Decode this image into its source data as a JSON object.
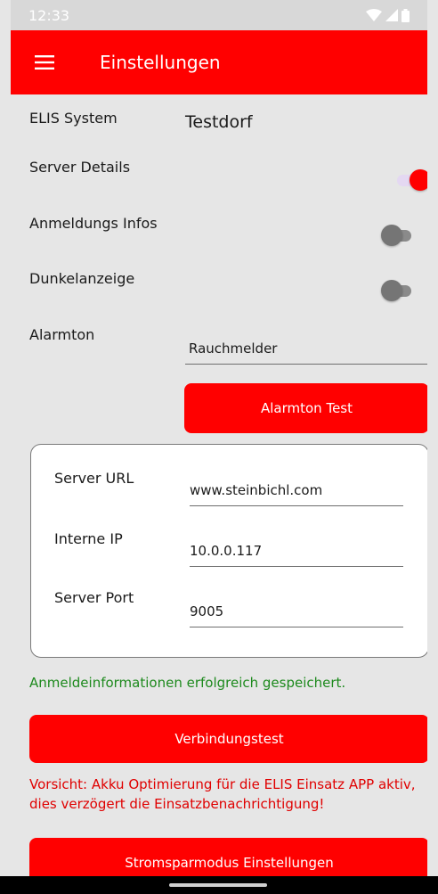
{
  "status_bar": {
    "time": "12:33",
    "icons": [
      "wifi-icon",
      "signal-icon",
      "battery-icon"
    ]
  },
  "app_bar": {
    "menu_icon": "hamburger-menu-icon",
    "title": "Einstellungen"
  },
  "settings": {
    "elis_system": {
      "label": "ELIS System",
      "value": "Testdorf"
    },
    "server_details": {
      "label": "Server Details",
      "enabled": true
    },
    "anmeldungs_infos": {
      "label": "Anmeldungs Infos",
      "enabled": false
    },
    "dunkelanzeige": {
      "label": "Dunkelanzeige",
      "enabled": false
    },
    "alarmton": {
      "label": "Alarmton",
      "value": "Rauchmelder"
    },
    "alarmton_test_button": "Alarmton Test"
  },
  "server_card": {
    "server_url": {
      "label": "Server URL",
      "value": "www.steinbichl.com"
    },
    "interne_ip": {
      "label": "Interne IP",
      "value": "10.0.0.117"
    },
    "server_port": {
      "label": "Server Port",
      "value": "9005"
    }
  },
  "messages": {
    "success": "Anmeldeinformationen erfolgreich gespeichert.",
    "warning": "Vorsicht: Akku Optimierung für die ELIS Einsatz APP aktiv, dies verzögert die Einsatzbenachrichtigung!"
  },
  "buttons": {
    "verbindungstest": "Verbindungstest",
    "stromsparmodus": "Stromsparmodus Einstellungen"
  },
  "colors": {
    "accent": "#ff0000",
    "success": "#1e8a1e",
    "warning": "#e00000",
    "background": "#e6e6e6"
  }
}
